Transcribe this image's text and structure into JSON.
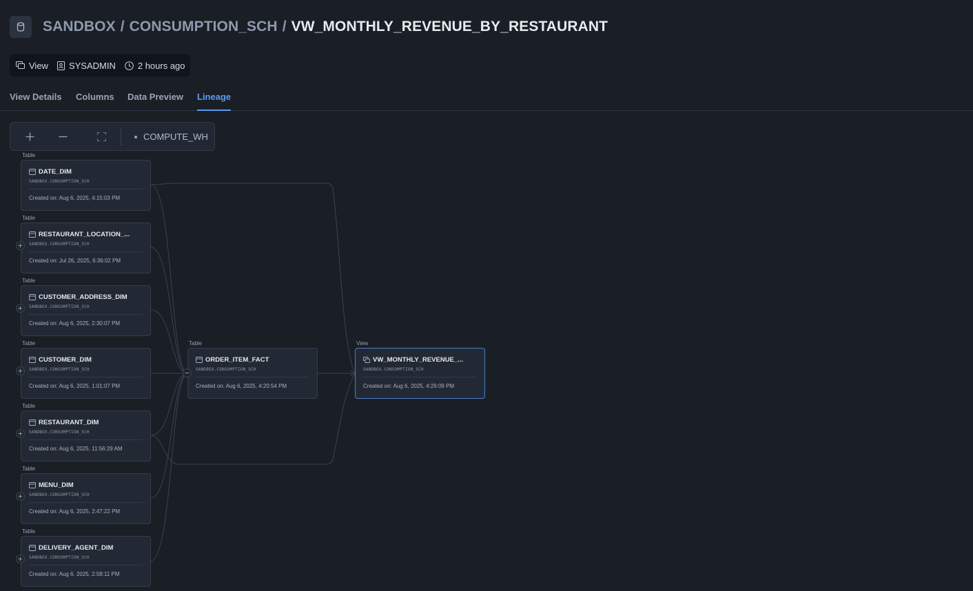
{
  "breadcrumb": {
    "database": "SANDBOX",
    "schema": "CONSUMPTION_SCH",
    "object": "VW_MONTHLY_REVENUE_BY_RESTAURANT",
    "separator": "/"
  },
  "meta": {
    "type": "View",
    "owner": "SYSADMIN",
    "modified": "2 hours ago"
  },
  "tabs": [
    {
      "label": "View Details",
      "active": false
    },
    {
      "label": "Columns",
      "active": false
    },
    {
      "label": "Data Preview",
      "active": false
    },
    {
      "label": "Lineage",
      "active": true
    }
  ],
  "toolbar": {
    "warehouse": "COMPUTE_WH"
  },
  "lineage": {
    "upstream": [
      {
        "type": "Table",
        "name": "DATE_DIM",
        "schema": "SANDBOX.CONSUMPTION_SCH",
        "created": "Created on: Aug 6, 2025, 4:15:03 PM"
      },
      {
        "type": "Table",
        "name": "RESTAURANT_LOCATION_...",
        "schema": "SANDBOX.CONSUMPTION_SCH",
        "created": "Created on: Jul 26, 2025, 6:36:02 PM"
      },
      {
        "type": "Table",
        "name": "CUSTOMER_ADDRESS_DIM",
        "schema": "SANDBOX.CONSUMPTION_SCH",
        "created": "Created on: Aug 6, 2025, 2:30:07 PM"
      },
      {
        "type": "Table",
        "name": "CUSTOMER_DIM",
        "schema": "SANDBOX.CONSUMPTION_SCH",
        "created": "Created on: Aug 6, 2025, 1:01:07 PM"
      },
      {
        "type": "Table",
        "name": "RESTAURANT_DIM",
        "schema": "SANDBOX.CONSUMPTION_SCH",
        "created": "Created on: Aug 6, 2025, 11:56:29 AM"
      },
      {
        "type": "Table",
        "name": "MENU_DIM",
        "schema": "SANDBOX.CONSUMPTION_SCH",
        "created": "Created on: Aug 6, 2025, 2:47:22 PM"
      },
      {
        "type": "Table",
        "name": "DELIVERY_AGENT_DIM",
        "schema": "SANDBOX.CONSUMPTION_SCH",
        "created": "Created on: Aug 6, 2025, 2:58:11 PM"
      }
    ],
    "fact": {
      "type": "Table",
      "name": "ORDER_ITEM_FACT",
      "schema": "SANDBOX.CONSUMPTION_SCH",
      "created": "Created on: Aug 6, 2025, 4:20:54 PM"
    },
    "target": {
      "type": "View",
      "name": "VW_MONTHLY_REVENUE_...",
      "schema": "SANDBOX.CONSUMPTION_SCH",
      "created": "Created on: Aug 6, 2025, 4:29:09 PM"
    }
  }
}
